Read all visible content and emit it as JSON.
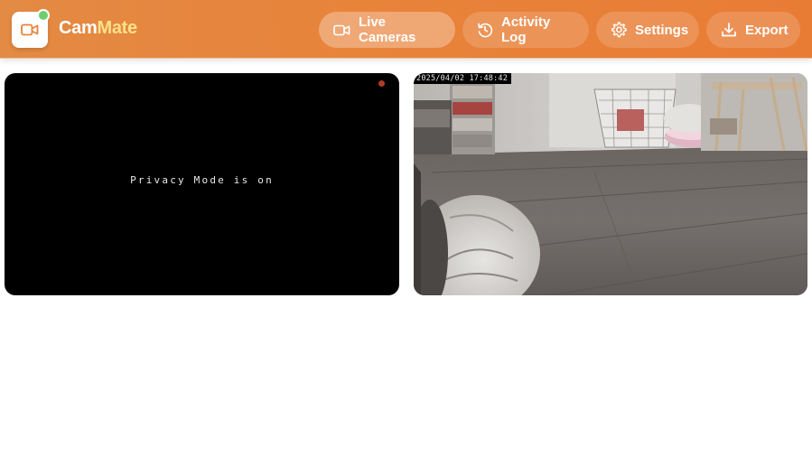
{
  "app": {
    "brand_prefix": "Cam",
    "brand_suffix": "Mate"
  },
  "nav": [
    {
      "label": "Live Cameras",
      "icon": "video-camera-icon",
      "active": true
    },
    {
      "label": "Activity Log",
      "icon": "history-icon",
      "active": false
    },
    {
      "label": "Settings",
      "icon": "gear-icon",
      "active": false
    },
    {
      "label": "Export",
      "icon": "download-icon",
      "active": false
    }
  ],
  "cameras": [
    {
      "overlay_text": "Privacy Mode is on",
      "status_color": "#b23a26"
    },
    {
      "timestamp": "2025/04/02 17:48:42"
    }
  ],
  "colors": {
    "accent": "#e8833a",
    "brand_highlight": "#ffe08a",
    "online_dot": "#6fcf6f"
  }
}
